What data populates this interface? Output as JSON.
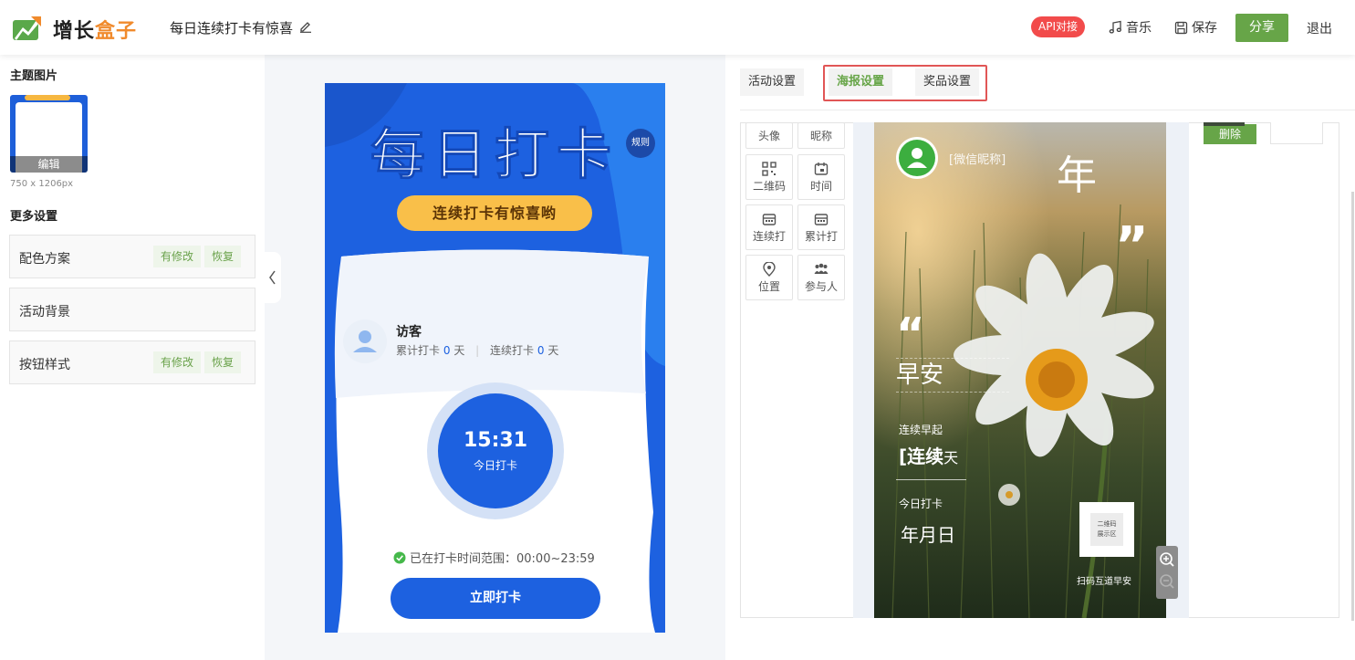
{
  "header": {
    "logo_a": "增长",
    "logo_b": "盒子",
    "activity_title": "每日连续打卡有惊喜",
    "api_badge": "API对接",
    "music": "音乐",
    "save": "保存",
    "share": "分享",
    "exit": "退出"
  },
  "left": {
    "theme_title": "主题图片",
    "thumb_edit": "编辑",
    "thumb_size": "750 x 1206px",
    "more_title": "更多设置",
    "rows": [
      {
        "label": "配色方案",
        "modified": "有修改",
        "restore": "恢复"
      },
      {
        "label": "活动背景"
      },
      {
        "label": "按钮样式",
        "modified": "有修改",
        "restore": "恢复"
      }
    ]
  },
  "preview": {
    "big_title": "每日打卡",
    "rules": "规则",
    "slogan": "连续打卡有惊喜哟",
    "visitor": "访客",
    "total_label": "累计打卡",
    "total_value": "0",
    "streak_label": "连续打卡",
    "streak_value": "0",
    "day_unit": "天",
    "time": "15:31",
    "today": "今日打卡",
    "range_text": "已在打卡时间范围：00:00~23:59",
    "checkin_button": "立即打卡"
  },
  "right": {
    "tabs": [
      {
        "label": "活动设置",
        "active": false
      },
      {
        "label": "海报设置",
        "active": true
      },
      {
        "label": "奖品设置",
        "active": false
      }
    ],
    "tools": [
      "头像",
      "昵称",
      "二维码",
      "时间",
      "连续打",
      "累计打",
      "位置",
      "参与人"
    ],
    "delete": "删除",
    "poster": {
      "nickname": "[微信昵称]",
      "year": "年",
      "quote_open": "“",
      "quote_close": "”",
      "greeting": "早安",
      "streak_label": "连续早起",
      "streak_value": "[连续",
      "streak_unit": "天",
      "today_label": "今日打卡",
      "date": "年月日",
      "qr_line1": "二维码",
      "qr_line2": "展示区",
      "scan": "扫码互道早安"
    }
  },
  "colors": {
    "brand_green": "#67a548",
    "phone_blue": "#1d61e0",
    "slogan_yellow": "#f9bf49",
    "highlight_red": "#e15656",
    "api_red": "#f24b4b"
  }
}
